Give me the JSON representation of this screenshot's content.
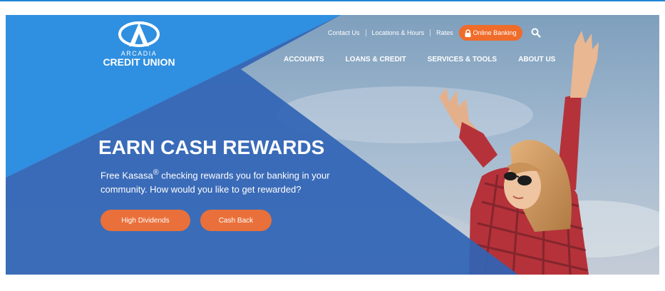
{
  "logo": {
    "small": "ARCADIA",
    "main": "CREDIT UNION"
  },
  "utility_nav": {
    "contact": "Contact Us",
    "locations": "Locations & Hours",
    "rates": "Rates",
    "online_banking": "Online Banking"
  },
  "main_nav": [
    "ACCOUNTS",
    "LOANS & CREDIT",
    "SERVICES & TOOLS",
    "ABOUT US"
  ],
  "hero": {
    "headline": "EARN CASH REWARDS",
    "desc_prefix": "Free Kasasa",
    "desc_mark": "®",
    "desc_rest": " checking rewards you for banking in your community. How would you like to get rewarded?",
    "cta_primary": "High Dividends",
    "cta_secondary": "Cash Back"
  },
  "colors": {
    "brand_blue": "#1e86d6",
    "accent_orange": "#ef6c2a"
  },
  "icons": [
    "arcadia-logo-icon",
    "lock-icon",
    "search-icon"
  ]
}
